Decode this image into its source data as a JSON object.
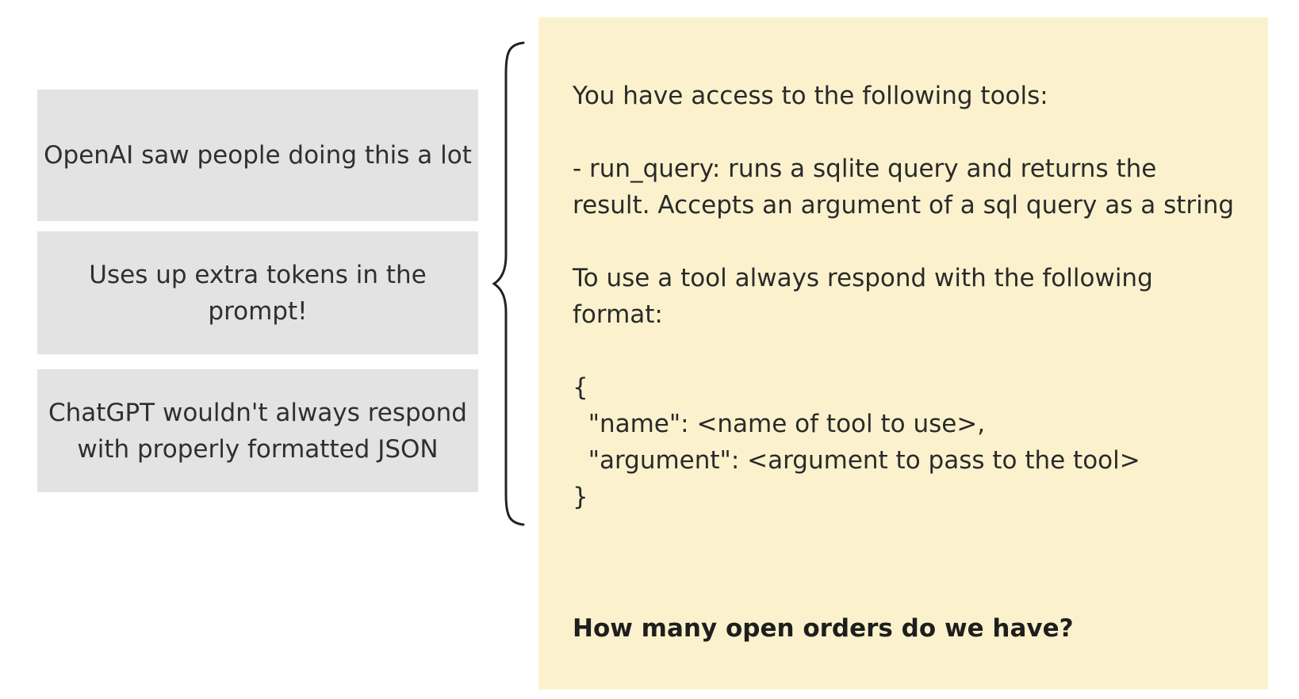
{
  "notes": [
    "OpenAI saw people doing this a lot",
    "Uses up extra tokens in the prompt!",
    "ChatGPT wouldn't always respond with properly formatted JSON"
  ],
  "prompt": {
    "intro": "You have access to the following tools:",
    "tool_line_1": "- run_query: runs a sqlite query and returns the",
    "tool_line_2": "result. Accepts an argument of a sql query as a string",
    "format_line_1": "To use a tool always respond with the following",
    "format_line_2": "format:",
    "json_open": "{",
    "json_name": "  \"name\": <name of tool to use>,",
    "json_argument": "  \"argument\": <argument to pass to the tool>",
    "json_close": "}",
    "question": "How many open orders do we have?"
  },
  "colors": {
    "note_background": "#e3e3e3",
    "prompt_background": "#fbf2cd",
    "brace": "#222222"
  }
}
